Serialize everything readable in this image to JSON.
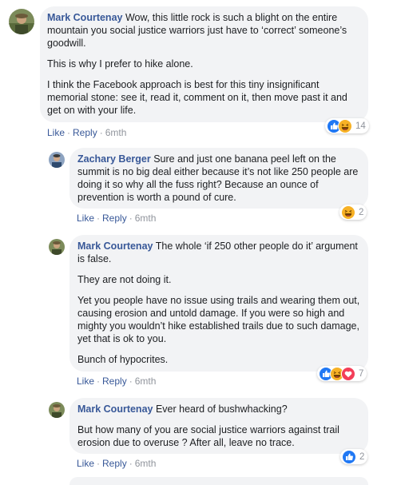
{
  "comments": [
    {
      "author": "Mark Courtenay",
      "paragraphs": [
        "Wow, this little rock is such a blight on the entire mountain you social justice warriors just have to ‘correct’ someone’s goodwill.",
        "This is why I prefer to hike alone.",
        "I think the Facebook approach is best for this tiny insignificant memorial stone: see it, read it, comment on it, then move past it and get on with your life."
      ],
      "like_label": "Like",
      "reply_label": "Reply",
      "time": "6mth",
      "reaction_count": "14",
      "reaction_icons": [
        "like-icon",
        "haha-icon"
      ]
    },
    {
      "author": "Zachary Berger",
      "paragraphs": [
        "Sure and just one banana peel left on the summit is no big deal either because it’s not like 250 people are doing it so why all the fuss right? Because an ounce of prevention is worth a pound of cure."
      ],
      "like_label": "Like",
      "reply_label": "Reply",
      "time": "6mth",
      "reaction_count": "2",
      "reaction_icons": [
        "haha-icon"
      ]
    },
    {
      "author": "Mark Courtenay",
      "paragraphs": [
        "The whole ‘if 250 other people do it’ argument is false.",
        "They are not doing it.",
        "Yet you people have no issue using trails and wearing them out, causing erosion and untold damage. If you were so high and mighty you wouldn’t hike established trails due to such damage, yet that is ok to you.",
        "Bunch of hypocrites."
      ],
      "like_label": "Like",
      "reply_label": "Reply",
      "time": "6mth",
      "reaction_count": "7",
      "reaction_icons": [
        "like-icon",
        "haha-icon",
        "love-icon"
      ]
    },
    {
      "author": "Mark Courtenay",
      "paragraphs": [
        "Ever heard of bushwhacking?",
        "But how many of you are social justice warriors against trail erosion due to overuse ? After all, leave no trace."
      ],
      "like_label": "Like",
      "reply_label": "Reply",
      "time": "6mth",
      "reaction_count": "2",
      "reaction_icons": [
        "like-icon"
      ]
    }
  ],
  "colors": {
    "author_link": "#385898",
    "bubble_bg": "#f2f3f5",
    "meta_text": "#90949c",
    "like_blue": "#2078f4",
    "haha_yellow": "#f7b125",
    "love_red": "#f33e58"
  }
}
